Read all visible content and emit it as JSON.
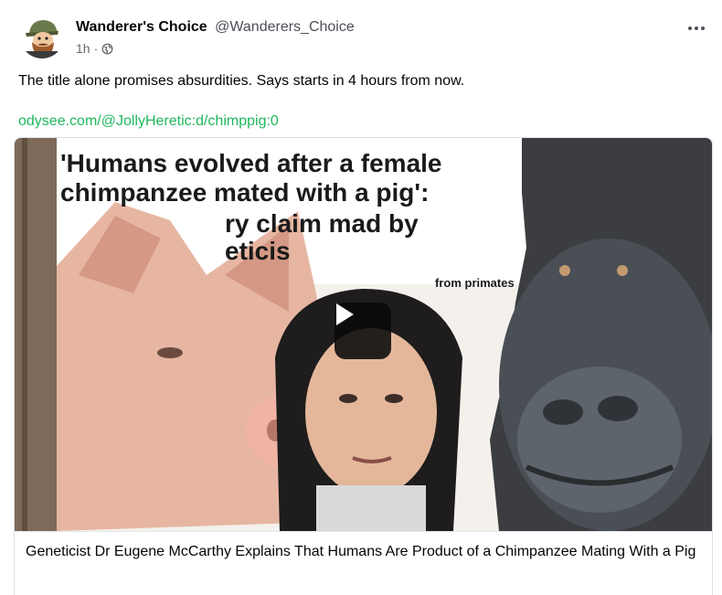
{
  "post": {
    "author_name": "Wanderer's Choice",
    "author_handle": "@Wanderers_Choice",
    "time": "1h",
    "separator": "·",
    "visibility_icon": "globe-icon",
    "more_icon": "more-options-icon",
    "text": "The title alone promises absurdities. Says starts in 4 hours from now.",
    "link_text": "odysee.com/@JollyHeretic:d/chimppig:0"
  },
  "card": {
    "thumbnail_headline": "'Humans evolved after a female chimpanzee mated with a pig':",
    "thumbnail_headline_2": "ry claim mad by",
    "thumbnail_headline_3": "eticis",
    "thumbnail_snippet": "from primates",
    "play_icon": "play-icon",
    "title": "Geneticist Dr Eugene McCarthy Explains That Humans Are Product of a Chimpanzee Mating With a Pig"
  },
  "colors": {
    "link": "#1fb85d",
    "text": "#050505",
    "secondary": "#65676b"
  }
}
